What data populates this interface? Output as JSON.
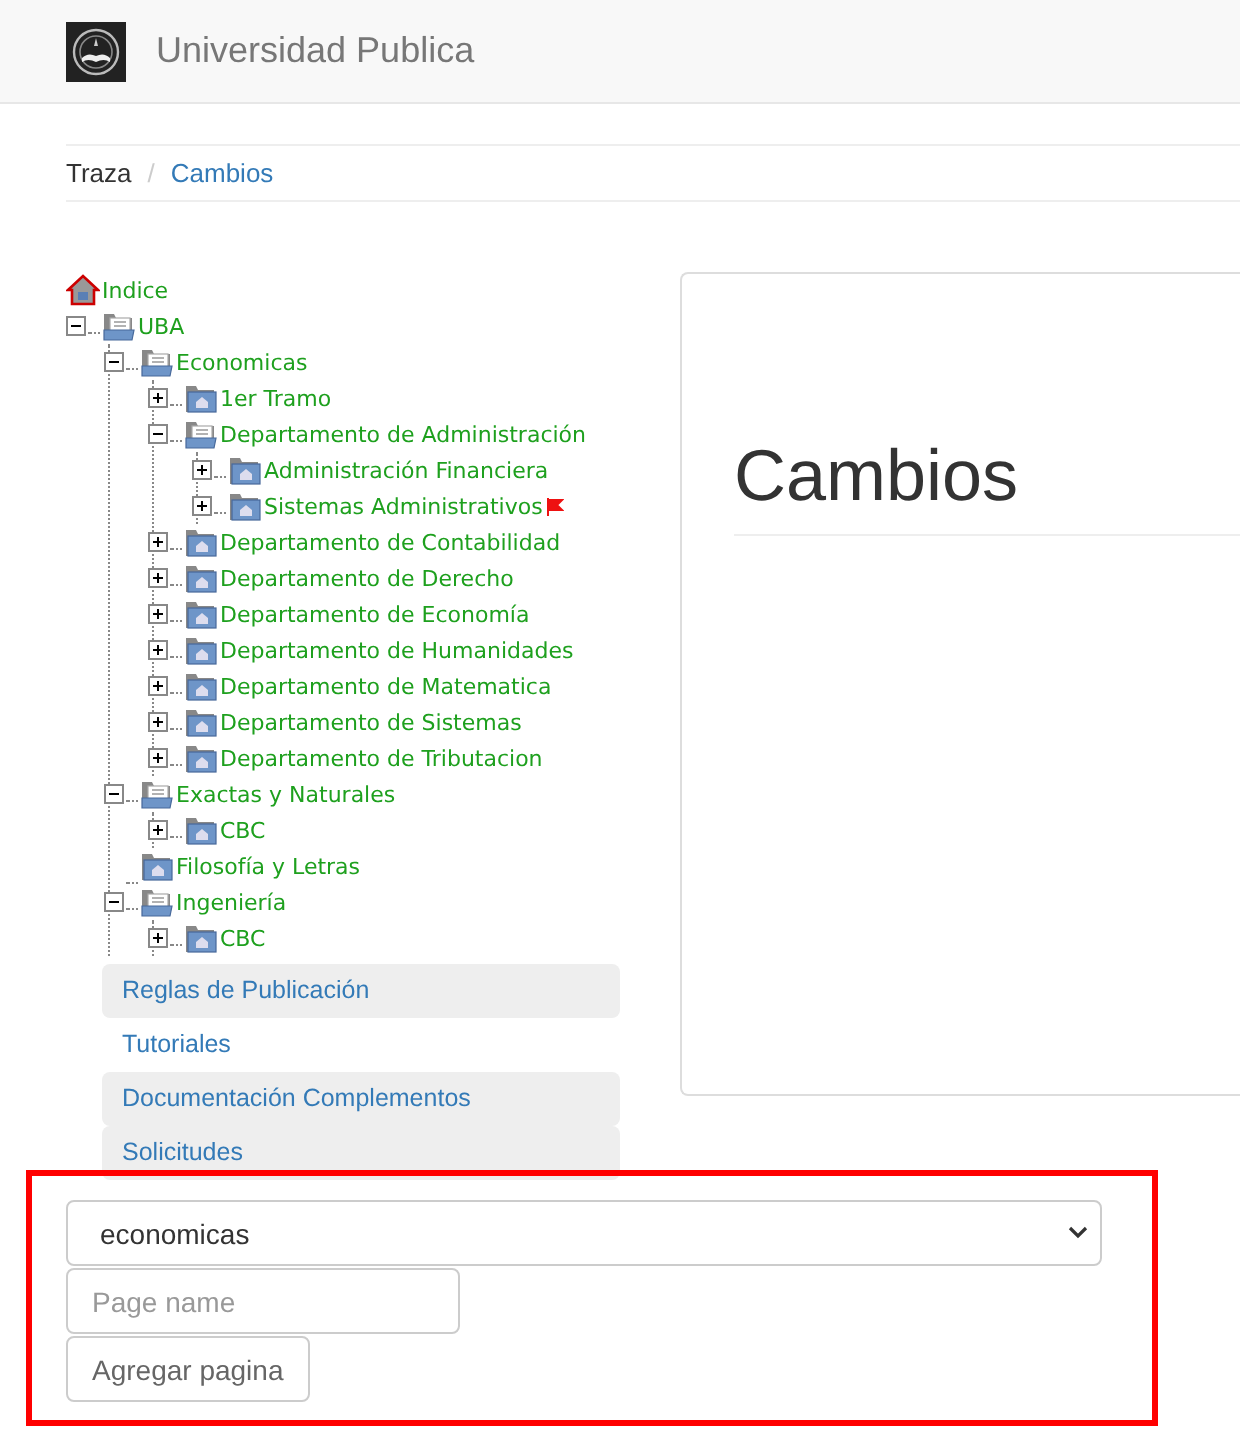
{
  "header": {
    "title": "Universidad Publica"
  },
  "breadcrumb_separator": "/",
  "breadcrumb": [
    {
      "label": "Traza",
      "kind": "text"
    },
    {
      "label": "Cambios",
      "kind": "link"
    }
  ],
  "tree": [
    {
      "kind": "home",
      "label": "Indice",
      "flagged": false
    },
    {
      "kind": "branch",
      "label": "UBA",
      "expanded": true,
      "flagged": false,
      "children": [
        {
          "kind": "branch",
          "label": "Economicas",
          "expanded": true,
          "flagged": false,
          "children": [
            {
              "kind": "branch",
              "label": "1er Tramo",
              "expanded": false,
              "flagged": false
            },
            {
              "kind": "branch",
              "label": "Departamento de Administración",
              "expanded": true,
              "flagged": false,
              "children": [
                {
                  "kind": "branch",
                  "label": "Administración Financiera",
                  "expanded": false,
                  "flagged": false
                },
                {
                  "kind": "branch",
                  "label": "Sistemas Administrativos",
                  "expanded": false,
                  "flagged": true
                }
              ]
            },
            {
              "kind": "branch",
              "label": "Departamento de Contabilidad",
              "expanded": false,
              "flagged": false
            },
            {
              "kind": "branch",
              "label": "Departamento de Derecho",
              "expanded": false,
              "flagged": false
            },
            {
              "kind": "branch",
              "label": "Departamento de Economía",
              "expanded": false,
              "flagged": false
            },
            {
              "kind": "branch",
              "label": "Departamento de Humanidades",
              "expanded": false,
              "flagged": false
            },
            {
              "kind": "branch",
              "label": "Departamento de Matematica",
              "expanded": false,
              "flagged": false
            },
            {
              "kind": "branch",
              "label": "Departamento de Sistemas",
              "expanded": false,
              "flagged": false
            },
            {
              "kind": "branch",
              "label": "Departamento de Tributacion",
              "expanded": false,
              "flagged": false
            }
          ]
        },
        {
          "kind": "branch",
          "label": "Exactas y Naturales",
          "expanded": true,
          "flagged": false,
          "children": [
            {
              "kind": "branch",
              "label": "CBC",
              "expanded": false,
              "flagged": false
            }
          ]
        },
        {
          "kind": "leaf",
          "label": "Filosofía y Letras",
          "flagged": false
        },
        {
          "kind": "branch",
          "label": "Ingeniería",
          "expanded": true,
          "flagged": false,
          "children": [
            {
              "kind": "branch",
              "label": "CBC",
              "expanded": false,
              "flagged": false
            }
          ]
        }
      ]
    }
  ],
  "menu": [
    {
      "label": "Reglas de Publicación",
      "shaded": true
    },
    {
      "label": "Tutoriales",
      "shaded": false
    },
    {
      "label": "Documentación Complementos",
      "shaded": true
    },
    {
      "label": "Solicitudes",
      "shaded": true
    }
  ],
  "panel": {
    "heading": "Cambios"
  },
  "form": {
    "select": {
      "value": "economicas"
    },
    "page_name": {
      "placeholder": "Page name"
    },
    "button": "Agregar pagina"
  }
}
